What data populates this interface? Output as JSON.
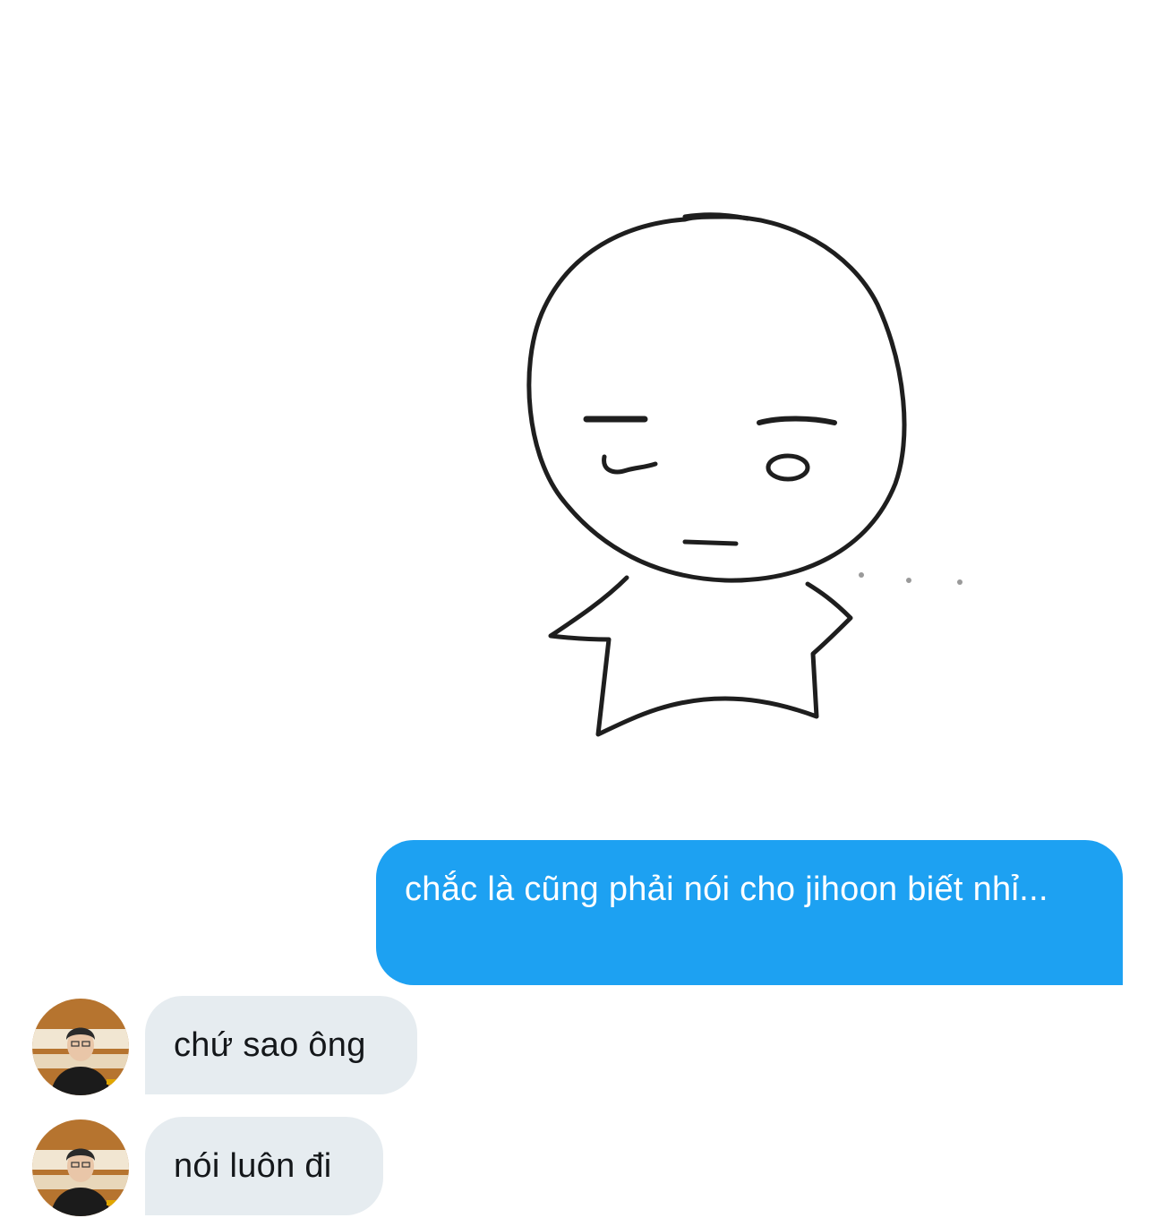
{
  "conversation": {
    "sticker": {
      "icon": "doodle-character-sticker"
    },
    "messages": [
      {
        "direction": "sent",
        "text": "chắc là cũng phải nói cho jihoon biết nhỉ..."
      },
      {
        "direction": "received",
        "text": "chứ sao ông",
        "avatar_icon": "user-avatar"
      },
      {
        "direction": "received",
        "text": "nói luôn đi",
        "avatar_icon": "user-avatar"
      }
    ]
  },
  "colors": {
    "sent_bubble": "#1da1f2",
    "received_bubble": "#e6ecf0",
    "background": "#ffffff",
    "received_text": "#14171a"
  }
}
